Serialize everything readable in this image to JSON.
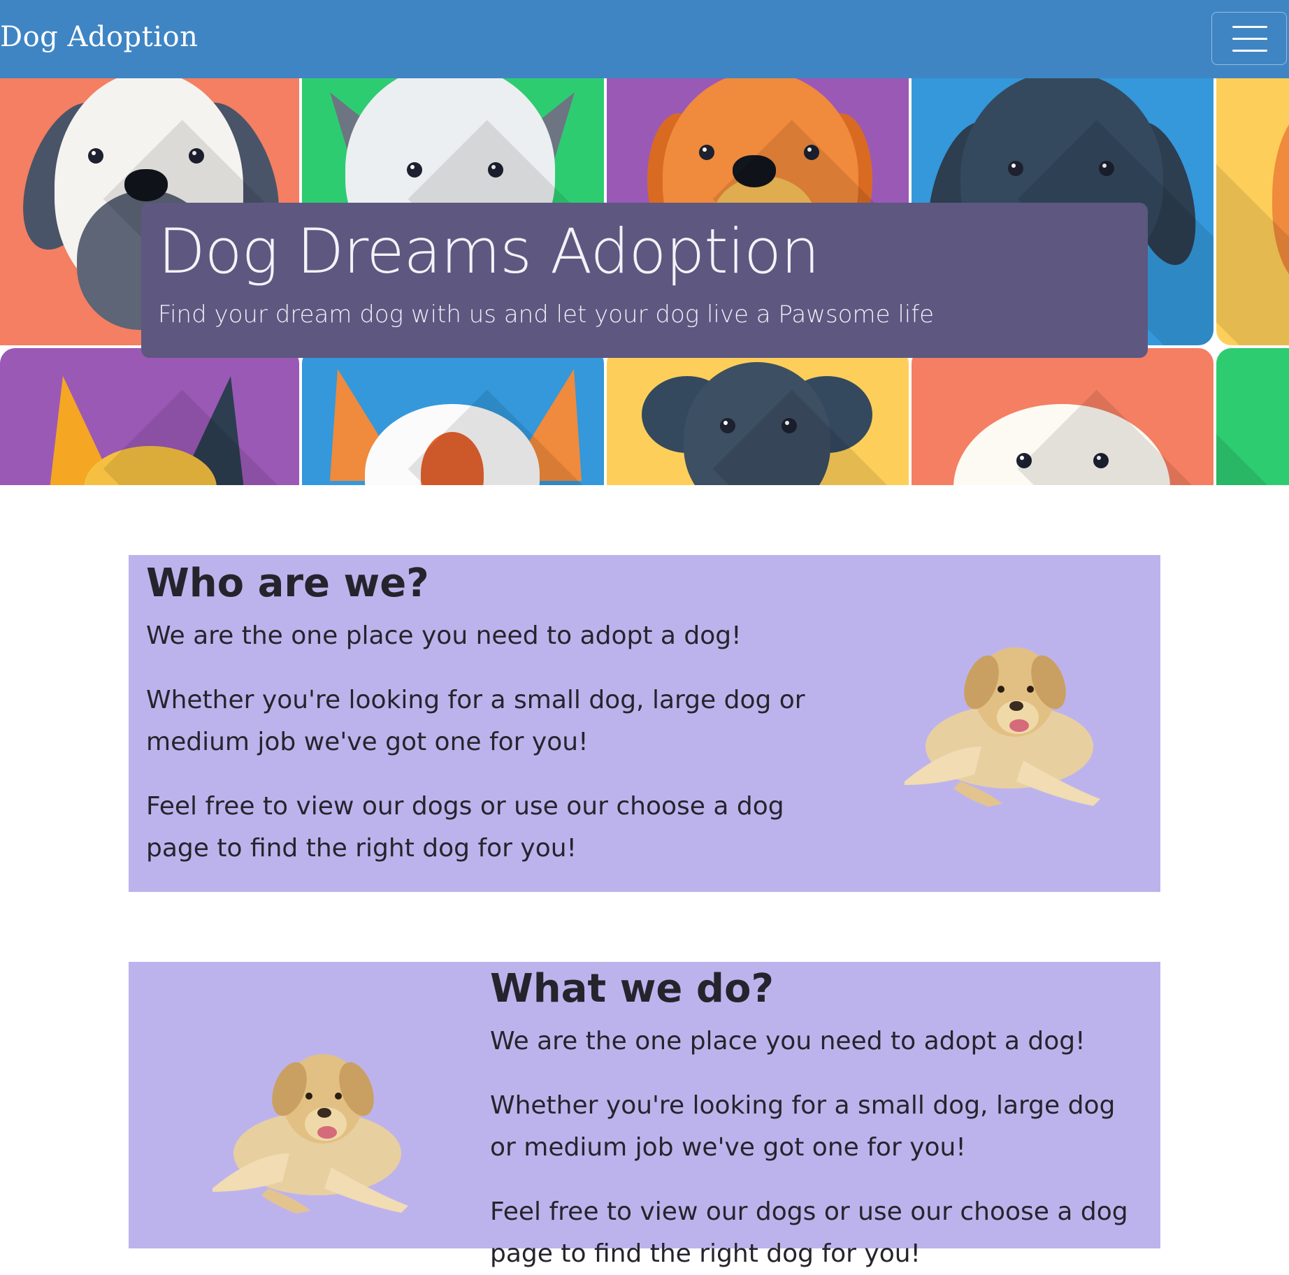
{
  "navbar": {
    "brand": "Dog Adoption",
    "toggle_icon": "hamburger-menu-icon",
    "background": "#3f85c4"
  },
  "hero": {
    "title": "Dog Dreams Adoption",
    "subtitle": "Find your dream dog with us and let your dog live a Pawsome life",
    "box_color": "#5e5780",
    "tile_colors": [
      "#f47f62",
      "#2ecc71",
      "#9b59b6",
      "#3498db",
      "#fdcf5a"
    ]
  },
  "about": {
    "heading": "Who are we?",
    "paragraphs": [
      "We are the one place you need to adopt a dog!",
      "Whether you're looking for a small dog, large dog or medium job we've got one for you!",
      "Feel free to view our dogs or use our choose a dog page to find the right dog for you!"
    ],
    "image": "labrador-photo"
  },
  "what_we_do": {
    "heading": "What we do?",
    "paragraphs": [
      "We are the one place you need to adopt a dog!",
      "Whether you're looking for a small dog, large dog or medium job we've got one for you!",
      "Feel free to view our dogs or use our choose a dog page to find the right dog for you!"
    ],
    "image": "labrador-photo"
  },
  "card_color": "#bdb3ec"
}
